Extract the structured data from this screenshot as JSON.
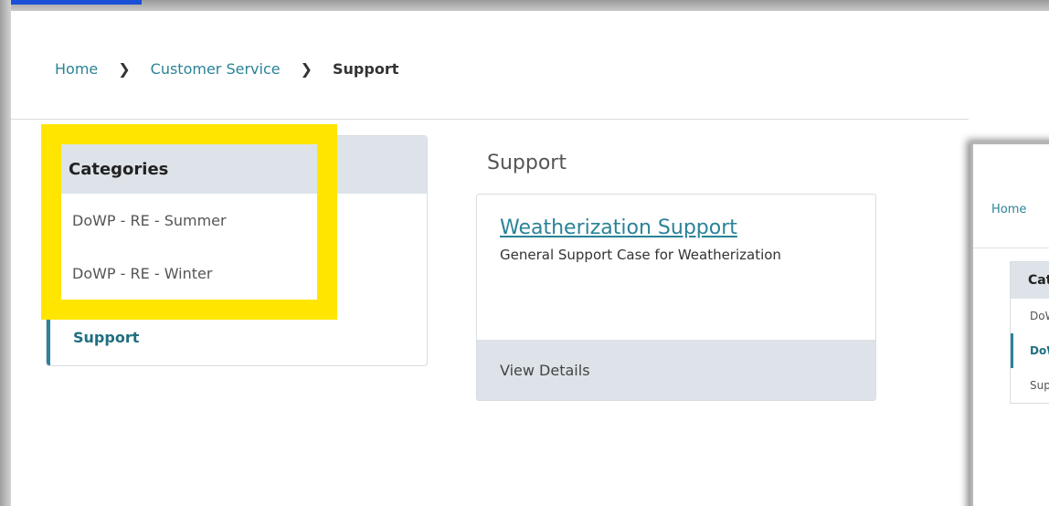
{
  "breadcrumb": {
    "home": "Home",
    "customer_service": "Customer Service",
    "current": "Support",
    "separator": "❯"
  },
  "categories": {
    "header": "Categories",
    "items": [
      {
        "label": "DoWP - RE - Summer"
      },
      {
        "label": "DoWP - RE - Winter"
      },
      {
        "label": "Support",
        "active": true
      }
    ]
  },
  "support": {
    "section_title": "Support",
    "card_title": "Weatherization Support",
    "card_description": "General Support Case for Weatherization",
    "view_details": "View Details"
  },
  "overlay_window": {
    "breadcrumb_home": "Home",
    "header": "Cat",
    "items": [
      {
        "label": "DoW"
      },
      {
        "label": "DoW",
        "active": true
      },
      {
        "label": "Sup"
      }
    ]
  },
  "colors": {
    "accent": "#2a8397",
    "highlight": "#ffe500",
    "panel_header": "#dde3e8"
  }
}
